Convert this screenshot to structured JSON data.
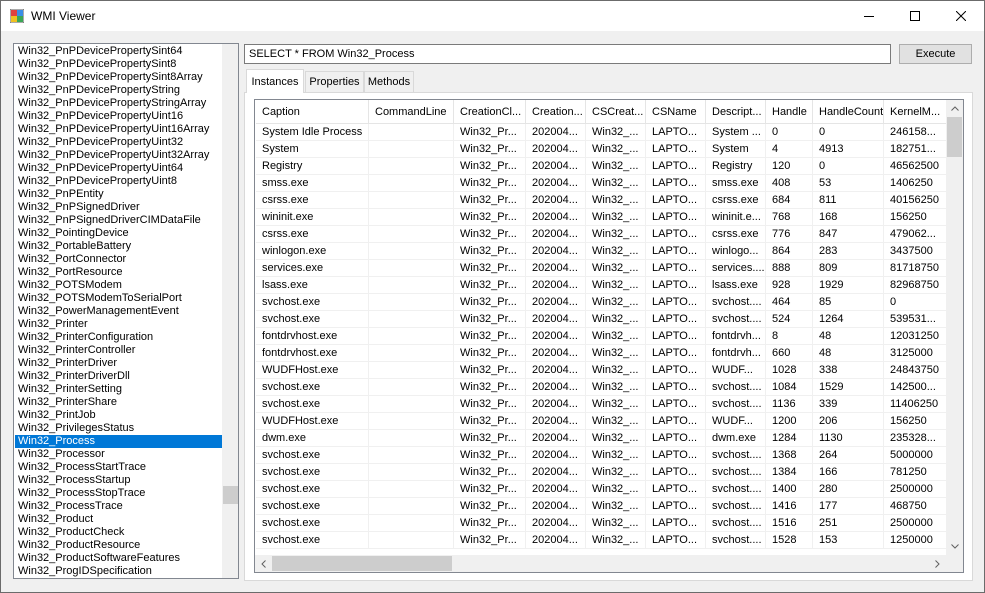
{
  "window": {
    "title": "WMI Viewer"
  },
  "classes": {
    "items": [
      "Win32_PnPDevicePropertySint64",
      "Win32_PnPDevicePropertySint8",
      "Win32_PnPDevicePropertySint8Array",
      "Win32_PnPDevicePropertyString",
      "Win32_PnPDevicePropertyStringArray",
      "Win32_PnPDevicePropertyUint16",
      "Win32_PnPDevicePropertyUint16Array",
      "Win32_PnPDevicePropertyUint32",
      "Win32_PnPDevicePropertyUint32Array",
      "Win32_PnPDevicePropertyUint64",
      "Win32_PnPDevicePropertyUint8",
      "Win32_PnPEntity",
      "Win32_PnPSignedDriver",
      "Win32_PnPSignedDriverCIMDataFile",
      "Win32_PointingDevice",
      "Win32_PortableBattery",
      "Win32_PortConnector",
      "Win32_PortResource",
      "Win32_POTSModem",
      "Win32_POTSModemToSerialPort",
      "Win32_PowerManagementEvent",
      "Win32_Printer",
      "Win32_PrinterConfiguration",
      "Win32_PrinterController",
      "Win32_PrinterDriver",
      "Win32_PrinterDriverDll",
      "Win32_PrinterSetting",
      "Win32_PrinterShare",
      "Win32_PrintJob",
      "Win32_PrivilegesStatus",
      "Win32_Process",
      "Win32_Processor",
      "Win32_ProcessStartTrace",
      "Win32_ProcessStartup",
      "Win32_ProcessStopTrace",
      "Win32_ProcessTrace",
      "Win32_Product",
      "Win32_ProductCheck",
      "Win32_ProductResource",
      "Win32_ProductSoftwareFeatures",
      "Win32_ProgIDSpecification"
    ],
    "selected_index": 30
  },
  "query": {
    "value": "SELECT * FROM Win32_Process"
  },
  "execute_label": "Execute",
  "tabs": [
    "Instances",
    "Properties",
    "Methods"
  ],
  "grid": {
    "columns": [
      "Caption",
      "CommandLine",
      "CreationCl...",
      "Creation...",
      "CSCreat...",
      "CSName",
      "Descript...",
      "Handle",
      "HandleCount",
      "KernelM..."
    ],
    "rows": [
      [
        "System Idle Process",
        "",
        "Win32_Pr...",
        "202004...",
        "Win32_...",
        "LAPTO...",
        "System ...",
        "0",
        "0",
        "246158..."
      ],
      [
        "System",
        "",
        "Win32_Pr...",
        "202004...",
        "Win32_...",
        "LAPTO...",
        "System",
        "4",
        "4913",
        "182751..."
      ],
      [
        "Registry",
        "",
        "Win32_Pr...",
        "202004...",
        "Win32_...",
        "LAPTO...",
        "Registry",
        "120",
        "0",
        "46562500"
      ],
      [
        "smss.exe",
        "",
        "Win32_Pr...",
        "202004...",
        "Win32_...",
        "LAPTO...",
        "smss.exe",
        "408",
        "53",
        "1406250"
      ],
      [
        "csrss.exe",
        "",
        "Win32_Pr...",
        "202004...",
        "Win32_...",
        "LAPTO...",
        "csrss.exe",
        "684",
        "811",
        "40156250"
      ],
      [
        "wininit.exe",
        "",
        "Win32_Pr...",
        "202004...",
        "Win32_...",
        "LAPTO...",
        "wininit.e...",
        "768",
        "168",
        "156250"
      ],
      [
        "csrss.exe",
        "",
        "Win32_Pr...",
        "202004...",
        "Win32_...",
        "LAPTO...",
        "csrss.exe",
        "776",
        "847",
        "479062..."
      ],
      [
        "winlogon.exe",
        "",
        "Win32_Pr...",
        "202004...",
        "Win32_...",
        "LAPTO...",
        "winlogo...",
        "864",
        "283",
        "3437500"
      ],
      [
        "services.exe",
        "",
        "Win32_Pr...",
        "202004...",
        "Win32_...",
        "LAPTO...",
        "services....",
        "888",
        "809",
        "81718750"
      ],
      [
        "lsass.exe",
        "",
        "Win32_Pr...",
        "202004...",
        "Win32_...",
        "LAPTO...",
        "lsass.exe",
        "928",
        "1929",
        "82968750"
      ],
      [
        "svchost.exe",
        "",
        "Win32_Pr...",
        "202004...",
        "Win32_...",
        "LAPTO...",
        "svchost....",
        "464",
        "85",
        "0"
      ],
      [
        "svchost.exe",
        "",
        "Win32_Pr...",
        "202004...",
        "Win32_...",
        "LAPTO...",
        "svchost....",
        "524",
        "1264",
        "539531..."
      ],
      [
        "fontdrvhost.exe",
        "",
        "Win32_Pr...",
        "202004...",
        "Win32_...",
        "LAPTO...",
        "fontdrvh...",
        "8",
        "48",
        "12031250"
      ],
      [
        "fontdrvhost.exe",
        "",
        "Win32_Pr...",
        "202004...",
        "Win32_...",
        "LAPTO...",
        "fontdrvh...",
        "660",
        "48",
        "3125000"
      ],
      [
        "WUDFHost.exe",
        "",
        "Win32_Pr...",
        "202004...",
        "Win32_...",
        "LAPTO...",
        "WUDF...",
        "1028",
        "338",
        "24843750"
      ],
      [
        "svchost.exe",
        "",
        "Win32_Pr...",
        "202004...",
        "Win32_...",
        "LAPTO...",
        "svchost....",
        "1084",
        "1529",
        "142500..."
      ],
      [
        "svchost.exe",
        "",
        "Win32_Pr...",
        "202004...",
        "Win32_...",
        "LAPTO...",
        "svchost....",
        "1136",
        "339",
        "11406250"
      ],
      [
        "WUDFHost.exe",
        "",
        "Win32_Pr...",
        "202004...",
        "Win32_...",
        "LAPTO...",
        "WUDF...",
        "1200",
        "206",
        "156250"
      ],
      [
        "dwm.exe",
        "",
        "Win32_Pr...",
        "202004...",
        "Win32_...",
        "LAPTO...",
        "dwm.exe",
        "1284",
        "1130",
        "235328..."
      ],
      [
        "svchost.exe",
        "",
        "Win32_Pr...",
        "202004...",
        "Win32_...",
        "LAPTO...",
        "svchost....",
        "1368",
        "264",
        "5000000"
      ],
      [
        "svchost.exe",
        "",
        "Win32_Pr...",
        "202004...",
        "Win32_...",
        "LAPTO...",
        "svchost....",
        "1384",
        "166",
        "781250"
      ],
      [
        "svchost.exe",
        "",
        "Win32_Pr...",
        "202004...",
        "Win32_...",
        "LAPTO...",
        "svchost....",
        "1400",
        "280",
        "2500000"
      ],
      [
        "svchost.exe",
        "",
        "Win32_Pr...",
        "202004...",
        "Win32_...",
        "LAPTO...",
        "svchost....",
        "1416",
        "177",
        "468750"
      ],
      [
        "svchost.exe",
        "",
        "Win32_Pr...",
        "202004...",
        "Win32_...",
        "LAPTO...",
        "svchost....",
        "1516",
        "251",
        "2500000"
      ],
      [
        "svchost.exe",
        "",
        "Win32_Pr...",
        "202004...",
        "Win32_...",
        "LAPTO...",
        "svchost....",
        "1528",
        "153",
        "1250000"
      ]
    ]
  },
  "colors": {
    "selection": "#0078d7"
  },
  "icons": {
    "app": "app-window-icon",
    "minimize": "minimize-icon",
    "maximize": "maximize-icon",
    "close": "close-icon"
  }
}
